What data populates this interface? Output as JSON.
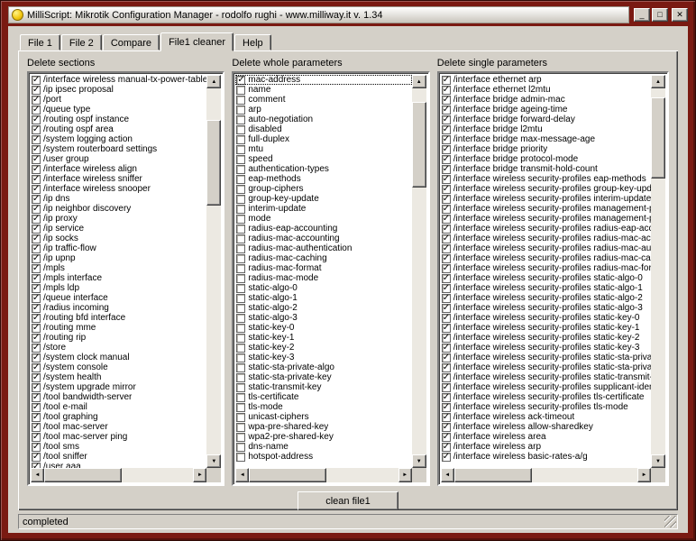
{
  "window": {
    "title": "MilliScript: Mikrotik Configuration Manager - rodolfo rughi - www.milliway.it v. 1.34",
    "status_text": "completed",
    "controls": {
      "minimize_glyph": "_",
      "maximize_glyph": "□",
      "close_glyph": "✕"
    },
    "frame_color": "#7a1a12",
    "face_color": "#d4d0c8"
  },
  "icons": {
    "check": "✓",
    "arrow_up": "▲",
    "arrow_down": "▼",
    "arrow_left": "◄",
    "arrow_right": "►"
  },
  "tabs": [
    {
      "label": "File 1",
      "active": false
    },
    {
      "label": "File 2",
      "active": false
    },
    {
      "label": "Compare",
      "active": false
    },
    {
      "label": "File1 cleaner",
      "active": true
    },
    {
      "label": "Help",
      "active": false
    }
  ],
  "actions": {
    "clean_button_label": "clean file1"
  },
  "panels": [
    {
      "title": "Delete sections",
      "items": [
        {
          "label": "/interface wireless manual-tx-power-table",
          "checked": true
        },
        {
          "label": "/ip ipsec proposal",
          "checked": true
        },
        {
          "label": "/port",
          "checked": true
        },
        {
          "label": "/queue type",
          "checked": true
        },
        {
          "label": "/routing ospf instance",
          "checked": true
        },
        {
          "label": "/routing ospf area",
          "checked": true
        },
        {
          "label": "/system logging action",
          "checked": true
        },
        {
          "label": "/system routerboard settings",
          "checked": true
        },
        {
          "label": "/user group",
          "checked": true
        },
        {
          "label": "/interface wireless align",
          "checked": true
        },
        {
          "label": "/interface wireless sniffer",
          "checked": true
        },
        {
          "label": "/interface wireless snooper",
          "checked": true
        },
        {
          "label": "/ip dns",
          "checked": true
        },
        {
          "label": "/ip neighbor discovery",
          "checked": true
        },
        {
          "label": "/ip proxy",
          "checked": true
        },
        {
          "label": "/ip service",
          "checked": true
        },
        {
          "label": "/ip socks",
          "checked": true
        },
        {
          "label": "/ip traffic-flow",
          "checked": true
        },
        {
          "label": "/ip upnp",
          "checked": true
        },
        {
          "label": "/mpls",
          "checked": true
        },
        {
          "label": "/mpls interface",
          "checked": true
        },
        {
          "label": "/mpls ldp",
          "checked": true
        },
        {
          "label": "/queue interface",
          "checked": true
        },
        {
          "label": "/radius incoming",
          "checked": true
        },
        {
          "label": "/routing bfd interface",
          "checked": true
        },
        {
          "label": "/routing mme",
          "checked": true
        },
        {
          "label": "/routing rip",
          "checked": true
        },
        {
          "label": "/store",
          "checked": true
        },
        {
          "label": "/system clock manual",
          "checked": true
        },
        {
          "label": "/system console",
          "checked": true
        },
        {
          "label": "/system health",
          "checked": true
        },
        {
          "label": "/system upgrade mirror",
          "checked": true
        },
        {
          "label": "/tool bandwidth-server",
          "checked": true
        },
        {
          "label": "/tool e-mail",
          "checked": true
        },
        {
          "label": "/tool graphing",
          "checked": true
        },
        {
          "label": "/tool mac-server",
          "checked": true
        },
        {
          "label": "/tool mac-server ping",
          "checked": true
        },
        {
          "label": "/tool sms",
          "checked": true
        },
        {
          "label": "/tool sniffer",
          "checked": true
        },
        {
          "label": "/user aaa",
          "checked": true
        }
      ]
    },
    {
      "title": "Delete whole parameters",
      "items": [
        {
          "label": "mac-address",
          "checked": true,
          "selected": true
        },
        {
          "label": "name",
          "checked": false
        },
        {
          "label": "comment",
          "checked": false
        },
        {
          "label": "arp",
          "checked": false
        },
        {
          "label": "auto-negotiation",
          "checked": false
        },
        {
          "label": "disabled",
          "checked": false
        },
        {
          "label": "full-duplex",
          "checked": false
        },
        {
          "label": "mtu",
          "checked": false
        },
        {
          "label": "speed",
          "checked": false
        },
        {
          "label": "authentication-types",
          "checked": false
        },
        {
          "label": "eap-methods",
          "checked": false
        },
        {
          "label": "group-ciphers",
          "checked": false
        },
        {
          "label": "group-key-update",
          "checked": false
        },
        {
          "label": "interim-update",
          "checked": false
        },
        {
          "label": "mode",
          "checked": false
        },
        {
          "label": "radius-eap-accounting",
          "checked": false
        },
        {
          "label": "radius-mac-accounting",
          "checked": false
        },
        {
          "label": "radius-mac-authentication",
          "checked": false
        },
        {
          "label": "radius-mac-caching",
          "checked": false
        },
        {
          "label": "radius-mac-format",
          "checked": false
        },
        {
          "label": "radius-mac-mode",
          "checked": false
        },
        {
          "label": "static-algo-0",
          "checked": false
        },
        {
          "label": "static-algo-1",
          "checked": false
        },
        {
          "label": "static-algo-2",
          "checked": false
        },
        {
          "label": "static-algo-3",
          "checked": false
        },
        {
          "label": "static-key-0",
          "checked": false
        },
        {
          "label": "static-key-1",
          "checked": false
        },
        {
          "label": "static-key-2",
          "checked": false
        },
        {
          "label": "static-key-3",
          "checked": false
        },
        {
          "label": "static-sta-private-algo",
          "checked": false
        },
        {
          "label": "static-sta-private-key",
          "checked": false
        },
        {
          "label": "static-transmit-key",
          "checked": false
        },
        {
          "label": "tls-certificate",
          "checked": false
        },
        {
          "label": "tls-mode",
          "checked": false
        },
        {
          "label": "unicast-ciphers",
          "checked": false
        },
        {
          "label": "wpa-pre-shared-key",
          "checked": false
        },
        {
          "label": "wpa2-pre-shared-key",
          "checked": false
        },
        {
          "label": "dns-name",
          "checked": false
        },
        {
          "label": "hotspot-address",
          "checked": false
        }
      ]
    },
    {
      "title": "Delete single parameters",
      "items": [
        {
          "label": "/interface ethernet arp",
          "checked": true
        },
        {
          "label": "/interface ethernet l2mtu",
          "checked": true
        },
        {
          "label": "/interface bridge admin-mac",
          "checked": true
        },
        {
          "label": "/interface bridge ageing-time",
          "checked": true
        },
        {
          "label": "/interface bridge forward-delay",
          "checked": true
        },
        {
          "label": "/interface bridge l2mtu",
          "checked": true
        },
        {
          "label": "/interface bridge max-message-age",
          "checked": true
        },
        {
          "label": "/interface bridge priority",
          "checked": true
        },
        {
          "label": "/interface bridge protocol-mode",
          "checked": true
        },
        {
          "label": "/interface bridge transmit-hold-count",
          "checked": true
        },
        {
          "label": "/interface wireless security-profiles eap-methods",
          "checked": true
        },
        {
          "label": "/interface wireless security-profiles group-key-update",
          "checked": true
        },
        {
          "label": "/interface wireless security-profiles interim-update",
          "checked": true
        },
        {
          "label": "/interface wireless security-profiles management-protection",
          "checked": true
        },
        {
          "label": "/interface wireless security-profiles management-protection-key",
          "checked": true
        },
        {
          "label": "/interface wireless security-profiles radius-eap-accounting",
          "checked": true
        },
        {
          "label": "/interface wireless security-profiles radius-mac-accounting",
          "checked": true
        },
        {
          "label": "/interface wireless security-profiles radius-mac-authentication",
          "checked": true
        },
        {
          "label": "/interface wireless security-profiles radius-mac-caching",
          "checked": true
        },
        {
          "label": "/interface wireless security-profiles radius-mac-format",
          "checked": true
        },
        {
          "label": "/interface wireless security-profiles static-algo-0",
          "checked": true
        },
        {
          "label": "/interface wireless security-profiles static-algo-1",
          "checked": true
        },
        {
          "label": "/interface wireless security-profiles static-algo-2",
          "checked": true
        },
        {
          "label": "/interface wireless security-profiles static-algo-3",
          "checked": true
        },
        {
          "label": "/interface wireless security-profiles static-key-0",
          "checked": true
        },
        {
          "label": "/interface wireless security-profiles static-key-1",
          "checked": true
        },
        {
          "label": "/interface wireless security-profiles static-key-2",
          "checked": true
        },
        {
          "label": "/interface wireless security-profiles static-key-3",
          "checked": true
        },
        {
          "label": "/interface wireless security-profiles static-sta-private-algo",
          "checked": true
        },
        {
          "label": "/interface wireless security-profiles static-sta-private-key",
          "checked": true
        },
        {
          "label": "/interface wireless security-profiles static-transmit-key",
          "checked": true
        },
        {
          "label": "/interface wireless security-profiles supplicant-identity",
          "checked": true
        },
        {
          "label": "/interface wireless security-profiles tls-certificate",
          "checked": true
        },
        {
          "label": "/interface wireless security-profiles tls-mode",
          "checked": true
        },
        {
          "label": "/interface wireless ack-timeout",
          "checked": true
        },
        {
          "label": "/interface wireless allow-sharedkey",
          "checked": true
        },
        {
          "label": "/interface wireless area",
          "checked": true
        },
        {
          "label": "/interface wireless arp",
          "checked": true
        },
        {
          "label": "/interface wireless basic-rates-a/g",
          "checked": true
        }
      ]
    }
  ]
}
